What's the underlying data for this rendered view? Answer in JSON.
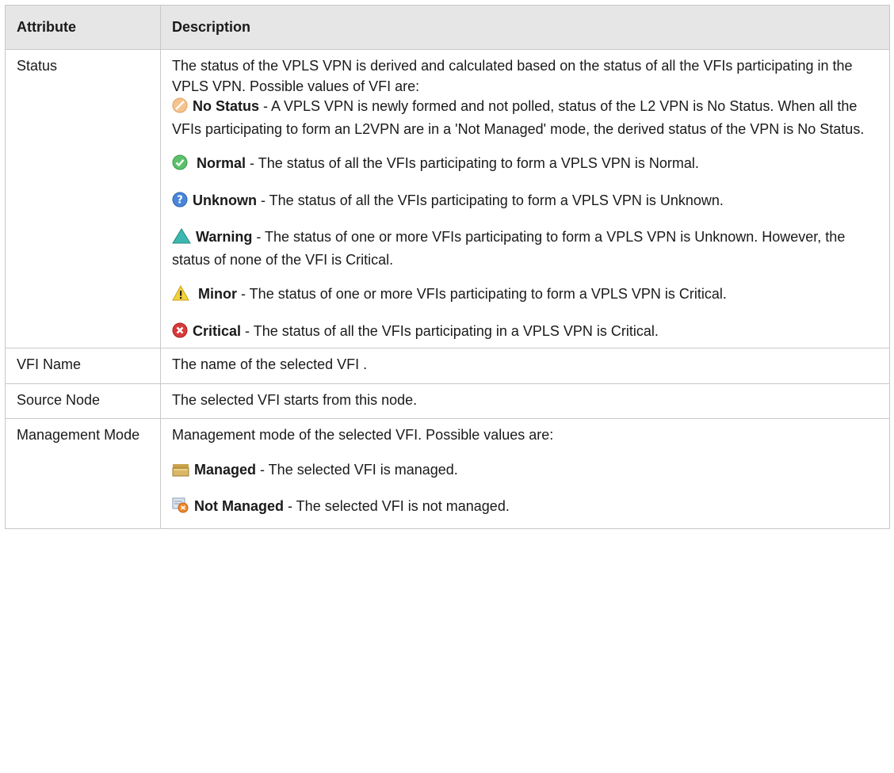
{
  "table": {
    "headers": {
      "attribute": "Attribute",
      "description": "Description"
    },
    "status": {
      "name": "Status",
      "intro": "The status of the VPLS VPN is derived and calculated based on the status of all the VFIs participating in the VPLS VPN. Possible values of VFI are:",
      "values": [
        {
          "icon": "no-status-icon",
          "label": "No Status",
          "text": " - A VPLS VPN is newly formed and not polled, status of the L2 VPN is No Status. When all the VFIs participating to form an L2VPN are in a 'Not Managed' mode, the derived status of the VPN is No Status."
        },
        {
          "icon": "normal-icon",
          "label": "Normal",
          "text": " - The status of all the VFIs participating to form a VPLS VPN is Normal."
        },
        {
          "icon": "unknown-icon",
          "label": "Unknown",
          "text": " - The status of all the VFIs participating to form a VPLS VPN is Unknown."
        },
        {
          "icon": "warning-icon",
          "label": "Warning",
          "text": " - The status of one or more VFIs participating to form a VPLS VPN is Unknown. However, the status of none of the VFI is Critical."
        },
        {
          "icon": "minor-icon",
          "label": "Minor",
          "text": " - The status of one or more VFIs participating to form a VPLS VPN is Critical."
        },
        {
          "icon": "critical-icon",
          "label": "Critical",
          "text": " - The status of all the VFIs participating in a VPLS VPN is Critical."
        }
      ]
    },
    "vfi_name": {
      "name": "VFI Name",
      "description": "The name of the selected VFI ."
    },
    "source_node": {
      "name": "Source Node",
      "description": "The selected VFI starts from this node."
    },
    "management_mode": {
      "name": "Management Mode",
      "intro": "Management mode of the selected VFI. Possible values are:",
      "values": [
        {
          "icon": "managed-icon",
          "label": "Managed",
          "text": " - The selected VFI is managed."
        },
        {
          "icon": "not-managed-icon",
          "label": "Not Managed",
          "text": " - The selected VFI is not managed."
        }
      ]
    }
  }
}
